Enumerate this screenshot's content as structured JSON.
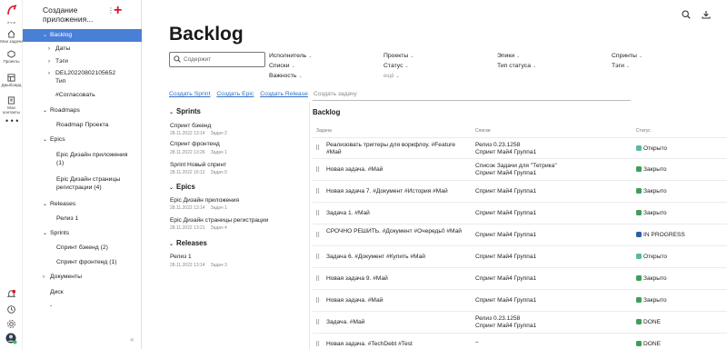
{
  "rail": {
    "logo_text": "eva",
    "items": [
      {
        "label": "Мои задачи",
        "icon": "home-icon"
      },
      {
        "label": "Проекты",
        "icon": "projects-icon"
      },
      {
        "label": "Дашбоард",
        "icon": "dashboard-icon"
      },
      {
        "label": "Мои контакты",
        "icon": "contacts-icon"
      }
    ],
    "more": "• • •"
  },
  "sidebar": {
    "project_title": "Создание приложения...",
    "more": "⋮",
    "add": "+",
    "collapse": "«",
    "items": [
      {
        "label": "Backlog",
        "arrow": "⌄",
        "active": true
      },
      {
        "label": "Даты",
        "arrow": "›"
      },
      {
        "label": "Тэги",
        "arrow": "›"
      },
      {
        "label": "DEL20220802105652",
        "arrow": "›"
      },
      {
        "label": "Тип",
        "arrow": ""
      },
      {
        "label": "#Согласовать",
        "arrow": ""
      },
      {
        "label": "Roadmaps",
        "arrow": "⌄"
      },
      {
        "label": "Roadmap Проекта",
        "arrow": ""
      },
      {
        "label": "Epics",
        "arrow": "⌄"
      },
      {
        "label": "Epic Дизайн приложения (1)",
        "arrow": ""
      },
      {
        "label": "Epic Дизайн страницы регистрации (4)",
        "arrow": ""
      },
      {
        "label": "Releases",
        "arrow": "⌄"
      },
      {
        "label": "Релиз 1",
        "arrow": ""
      },
      {
        "label": "Sprints",
        "arrow": "⌄"
      },
      {
        "label": "Спринт бэкенд (2)",
        "arrow": ""
      },
      {
        "label": "Спринт фронтенд (1)",
        "arrow": ""
      },
      {
        "label": "Документы",
        "arrow": "›"
      },
      {
        "label": "Диск",
        "arrow": ""
      },
      {
        "label": "-",
        "arrow": ""
      }
    ]
  },
  "main": {
    "title": "Backlog",
    "search_placeholder": "Содержит",
    "filters": [
      "Исполнитель",
      "Проекты",
      "Эпики",
      "Спринты",
      "Списки",
      "Статус",
      "Тип статуса",
      "Тэги",
      "Важность"
    ],
    "filters_more": "ещё",
    "links": [
      "Создать Sprint",
      "Создать Epic",
      "Создать Release"
    ],
    "add_task_placeholder": "Создать задачу",
    "backlog_heading": "Backlog",
    "columns": {
      "task": "Задача",
      "lists": "Списки",
      "status": "Статус"
    }
  },
  "panel": {
    "sprints_title": "Sprints",
    "sprints": [
      {
        "name": "Спринт бэкенд",
        "date": "28.11.2022 13:14",
        "tasks": "Задач 2"
      },
      {
        "name": "Спринт фронтенд",
        "date": "28.11.2022 13:26",
        "tasks": "Задач 1"
      },
      {
        "name": "Sprint Новый спринт",
        "date": "28.11.2022 16:12",
        "tasks": "Задач 0"
      }
    ],
    "epics_title": "Epics",
    "epics": [
      {
        "name": "Epic Дизайн приложения",
        "date": "28.11.2022 13:14",
        "tasks": "Задач 1"
      },
      {
        "name": "Epic Дизайн страницы регистрации",
        "date": "28.11.2022 13:21",
        "tasks": "Задач 4"
      }
    ],
    "releases_title": "Releases",
    "releases": [
      {
        "name": "Релиз 1",
        "date": "28.11.2022 13:14",
        "tasks": "Задач 3"
      }
    ]
  },
  "tasks": [
    {
      "title": "Реализовать триггеры для воркфлоу. #Feature #Май",
      "lists": "Релиз 0.23.1258\nСпринт Май4 Группа1",
      "status": "Открыто",
      "status_color": "#5bb8a6"
    },
    {
      "title": "Новая задача. #Май",
      "lists": "Список Задачи для \"Тетрика\"\nСпринт Май4 Группа1",
      "status": "Закрыто",
      "status_color": "#3f9e5a"
    },
    {
      "title": "Новая задача 7. #Документ #История #Май",
      "lists": "Спринт Май4 Группа1",
      "status": "Закрыто",
      "status_color": "#3f9e5a"
    },
    {
      "title": "Задача 1. #Май",
      "lists": "Спринт Май4 Группа1",
      "status": "Закрыто",
      "status_color": "#3f9e5a"
    },
    {
      "title": "СРОЧНО РЕШИТЬ. #Документ #Очередь0 #Май",
      "lists": "Спринт Май4 Группа1",
      "status": "IN PROGRESS",
      "status_color": "#2f5fa8"
    },
    {
      "title": "Задача 6. #Документ #Купить #Май",
      "lists": "Спринт Май4 Группа1",
      "status": "Открыто",
      "status_color": "#5bb8a6"
    },
    {
      "title": "Новая задача 9. #Май",
      "lists": "Спринт Май4 Группа1",
      "status": "Закрыто",
      "status_color": "#3f9e5a"
    },
    {
      "title": "Новая задача. #Май",
      "lists": "Спринт Май4 Группа1",
      "status": "Закрыто",
      "status_color": "#3f9e5a"
    },
    {
      "title": "Задача. #Май",
      "lists": "Релиз 0.23.1258\nСпринт Май4 Группа1",
      "status": "DONE",
      "status_color": "#3f9e5a"
    },
    {
      "title": "Новая задача. #TechDebt #Test",
      "lists": "–",
      "status": "DONE",
      "status_color": "#3f9e5a"
    }
  ],
  "colors": {
    "accent": "#4a7fd6",
    "brand": "#d9132b",
    "link": "#2f6fc4"
  }
}
